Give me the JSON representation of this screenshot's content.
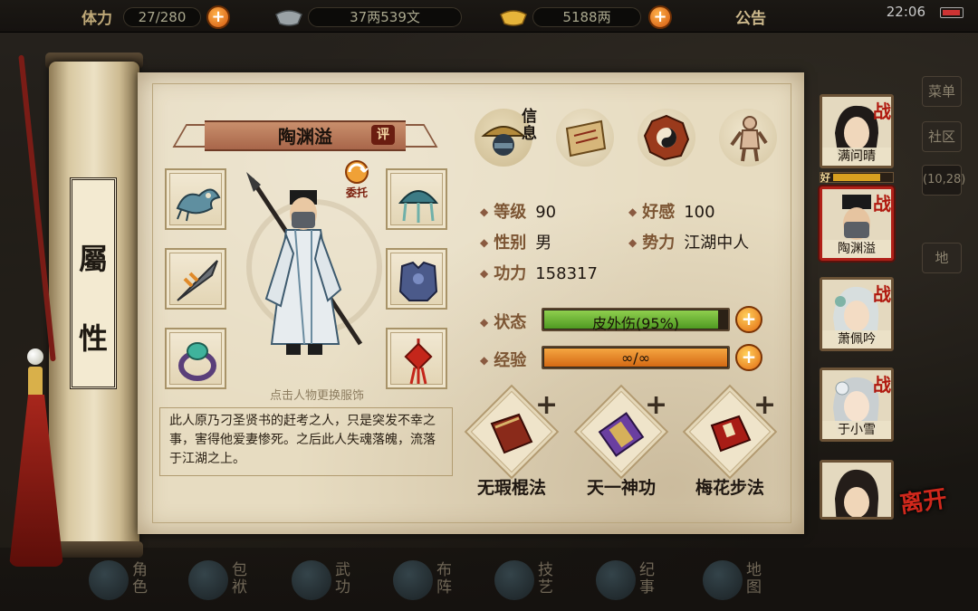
{
  "topbar": {
    "stamina_label": "体力",
    "stamina_value": "27/280",
    "silver_value": "37两539文",
    "gold_value": "5188两",
    "notice_label": "公告",
    "clock": "22:06"
  },
  "side_menu": {
    "menu_label": "菜单",
    "community_label": "社区",
    "coords": "(10,28)",
    "map_label": "地"
  },
  "bottom_nav": [
    {
      "label": "角色"
    },
    {
      "label": "包袱"
    },
    {
      "label": "武功"
    },
    {
      "label": "布阵"
    },
    {
      "label": "技艺"
    },
    {
      "label": "纪事"
    },
    {
      "label": "地图"
    }
  ],
  "scroll": {
    "title_top": "屬",
    "title_bottom": "性"
  },
  "character": {
    "name": "陶渊溢",
    "rate_badge": "评",
    "commission_label": "委托",
    "change_outfit_hint": "点击人物更换服饰",
    "bio": "此人原乃刁圣贤书的赶考之人，只是突发不幸之事，害得他爱妻惨死。之后此人失魂落魄，流落于江湖之上。"
  },
  "tabs": {
    "info_caption": "信息",
    "icons": [
      "info-hat-icon",
      "scroll-bag-icon",
      "bagua-icon",
      "meridian-body-icon"
    ]
  },
  "stats": {
    "level_label": "等级",
    "level_value": "90",
    "favor_label": "好感",
    "favor_value": "100",
    "gender_label": "性别",
    "gender_value": "男",
    "faction_label": "势力",
    "faction_value": "江湖中人",
    "power_label": "功力",
    "power_value": "158317",
    "status_label": "状态",
    "status_text": "皮外伤(95%)",
    "status_percent": 95,
    "exp_label": "经验",
    "exp_text": "∞/∞",
    "exp_percent": 100
  },
  "skills": [
    {
      "name": "无瑕棍法",
      "icon": "red-book-icon"
    },
    {
      "name": "天一神功",
      "icon": "purple-scroll-icon"
    },
    {
      "name": "梅花步法",
      "icon": "red-tome-icon"
    }
  ],
  "roster": [
    {
      "name": "满问晴",
      "badge": "战"
    },
    {
      "name": "陶渊溢",
      "badge": "战",
      "selected": true
    },
    {
      "name": "萧佩吟",
      "badge": "战"
    },
    {
      "name": "于小雪",
      "badge": "战"
    },
    {
      "name": "",
      "badge": ""
    }
  ],
  "roster_favor_tag": "好",
  "leave_label": "离开",
  "colors": {
    "status_fill": "#5faa2a",
    "exp_fill": "#e07a1c",
    "accent_red": "#b0190f",
    "paper": "#e7dcc1"
  }
}
